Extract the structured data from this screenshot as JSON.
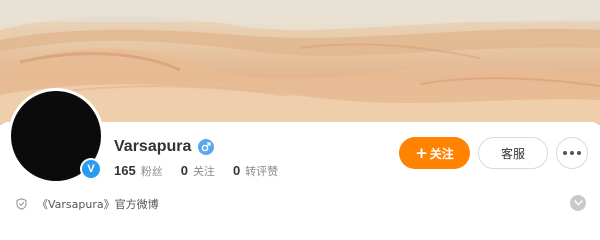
{
  "profile": {
    "name": "Varsapura",
    "gender_icon": "male-icon",
    "verified_icon": "verified-v-icon",
    "verified_glyph": "V"
  },
  "stats": [
    {
      "value": "165",
      "label": "粉丝"
    },
    {
      "value": "0",
      "label": "关注"
    },
    {
      "value": "0",
      "label": "转评赞"
    }
  ],
  "buttons": {
    "follow_plus": "+",
    "follow_label": "关注",
    "service_label": "客服",
    "more_icon": "more-dots-icon"
  },
  "description": {
    "icon": "shield-icon",
    "text": "《Varsapura》官方微博",
    "expand_icon": "chevron-down-icon"
  },
  "colors": {
    "accent": "#ff8200",
    "verified": "#2a9cf0",
    "gender": "#5aa9f0"
  }
}
